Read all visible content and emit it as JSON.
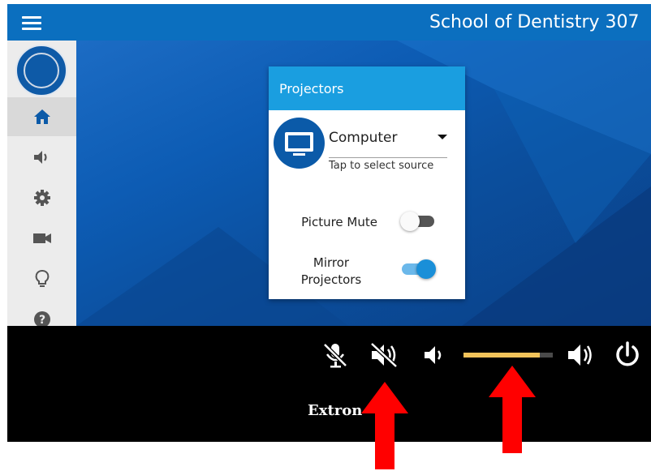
{
  "header": {
    "title": "School of Dentistry 307",
    "menu_icon": "hamburger-menu-icon"
  },
  "sidebar": {
    "logo": "university-seal",
    "items": [
      {
        "icon": "home-icon",
        "active": true
      },
      {
        "icon": "speaker-icon",
        "active": false
      },
      {
        "icon": "gear-icon",
        "active": false
      },
      {
        "icon": "video-camera-icon",
        "active": false
      },
      {
        "icon": "lightbulb-icon",
        "active": false
      },
      {
        "icon": "help-icon",
        "active": false
      }
    ]
  },
  "card": {
    "title": "Projectors",
    "source": {
      "icon": "monitor-icon",
      "selected": "Computer",
      "help": "Tap to select source"
    },
    "picture_mute": {
      "label": "Picture Mute",
      "on": false
    },
    "mirror": {
      "label_line1": "Mirror",
      "label_line2": "Projectors",
      "on": true
    }
  },
  "audio_bar": {
    "controls": [
      "mic-mute-icon",
      "speaker-mute-icon",
      "volume-down-icon",
      "volume-up-icon",
      "power-icon"
    ],
    "volume_level": 0.85
  },
  "footer": {
    "brand": "Extron"
  },
  "annotations": {
    "arrow_color": "#ff0000"
  },
  "colors": {
    "header": "#0b6fbf",
    "card_header": "#1a9ee0",
    "toggle_on": "#1a8fd8",
    "volume_fill": "#f2c35a"
  }
}
